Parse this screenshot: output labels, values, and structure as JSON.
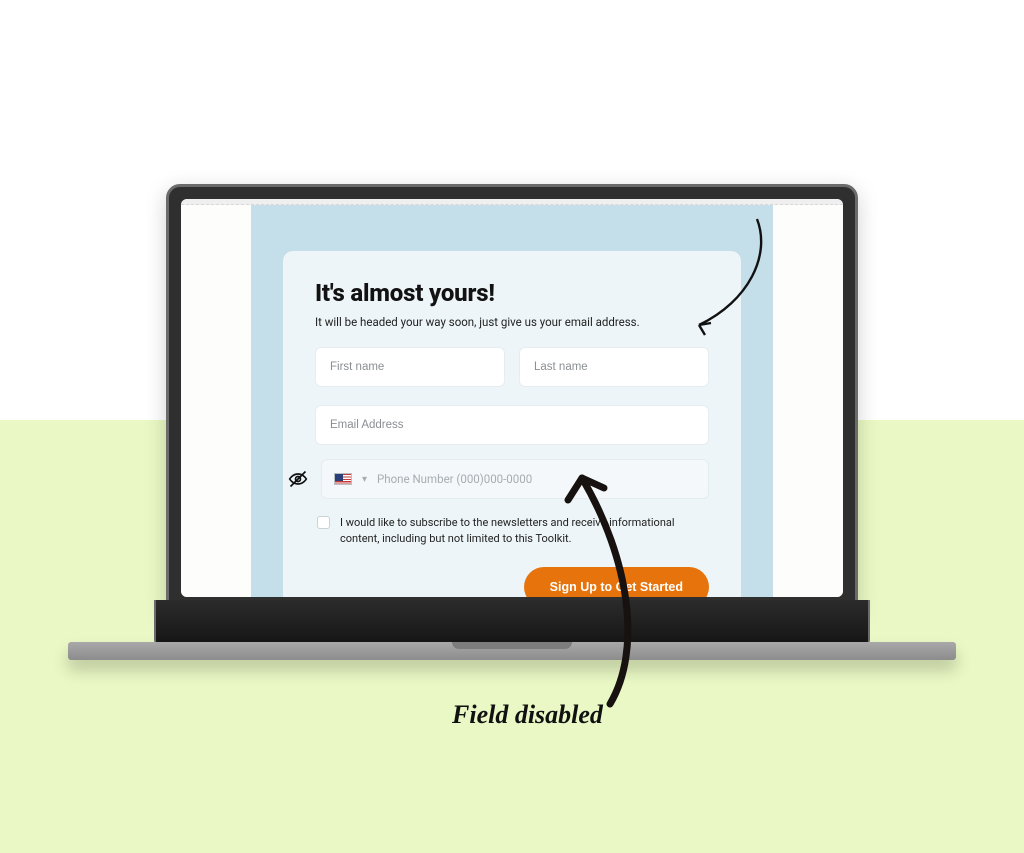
{
  "form": {
    "title": "It's almost yours!",
    "subtitle": "It will be headed your way soon, just give us your email address.",
    "first_name_placeholder": "First name",
    "last_name_placeholder": "Last name",
    "email_placeholder": "Email Address",
    "phone_placeholder": "Phone Number (000)000-0000",
    "country_code_dropdown_glyph": "▾",
    "checkbox_label": "I would like to subscribe to the newsletters and receive informational content, including but not limited to this Toolkit.",
    "cta_label": "Sign Up to Get Started"
  },
  "annotation": {
    "label": "Field disabled"
  }
}
